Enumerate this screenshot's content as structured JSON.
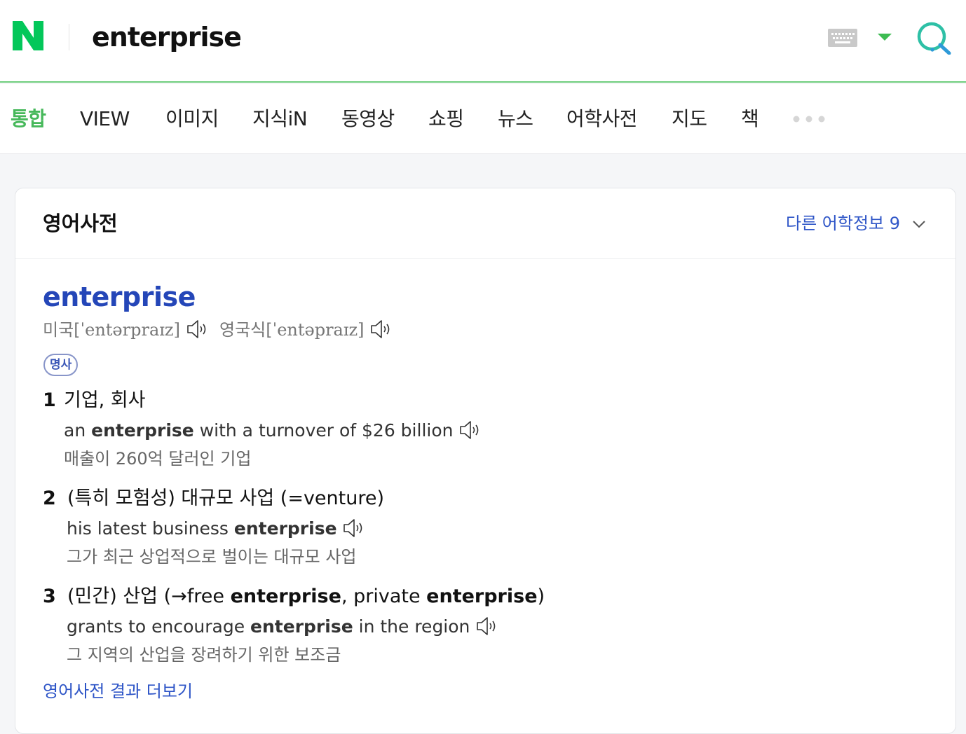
{
  "header": {
    "logo_letter": "N",
    "query": "enterprise",
    "brand_color": "#03c75a",
    "icons": [
      "keyboard-icon",
      "dropdown-arrow-icon",
      "search-icon"
    ]
  },
  "tabs": [
    {
      "label": "통합",
      "active": true
    },
    {
      "label": "VIEW"
    },
    {
      "label": "이미지"
    },
    {
      "label": "지식iN"
    },
    {
      "label": "동영상"
    },
    {
      "label": "쇼핑"
    },
    {
      "label": "뉴스"
    },
    {
      "label": "어학사전"
    },
    {
      "label": "지도"
    },
    {
      "label": "책"
    }
  ],
  "dict": {
    "title": "영어사전",
    "other_info_label": "다른 어학정보 9",
    "headword": "enterprise",
    "pron_us_label": "미국[",
    "pron_us_ipa": "ˈentərpraɪz]",
    "pron_uk_label": "영국식[",
    "pron_uk_ipa": "ˈentəpraɪz]",
    "pos": "명사",
    "senses": [
      {
        "num": "1",
        "definition": "기업, 회사",
        "example_pre": "an ",
        "example_bold": "enterprise",
        "example_post": " with a turnover of $26 billion",
        "translation": "매출이 260억 달러인 기업"
      },
      {
        "num": "2",
        "definition": "(특히 모험성) 대규모 사업 (=venture)",
        "example_pre": "his latest business ",
        "example_bold": "enterprise",
        "example_post": "",
        "translation": "그가 최근 상업적으로 벌이는 대규모 사업"
      },
      {
        "num": "3",
        "def_pre": "(민간) 산업 (→free ",
        "def_bold1": "enterprise",
        "def_mid": ", private ",
        "def_bold2": "enterprise",
        "def_post": ")",
        "example_pre": "grants to encourage ",
        "example_bold": "enterprise",
        "example_post": " in the region",
        "translation": "그 지역의 산업을 장려하기 위한 보조금"
      }
    ],
    "more_link": "영어사전 결과 더보기"
  }
}
